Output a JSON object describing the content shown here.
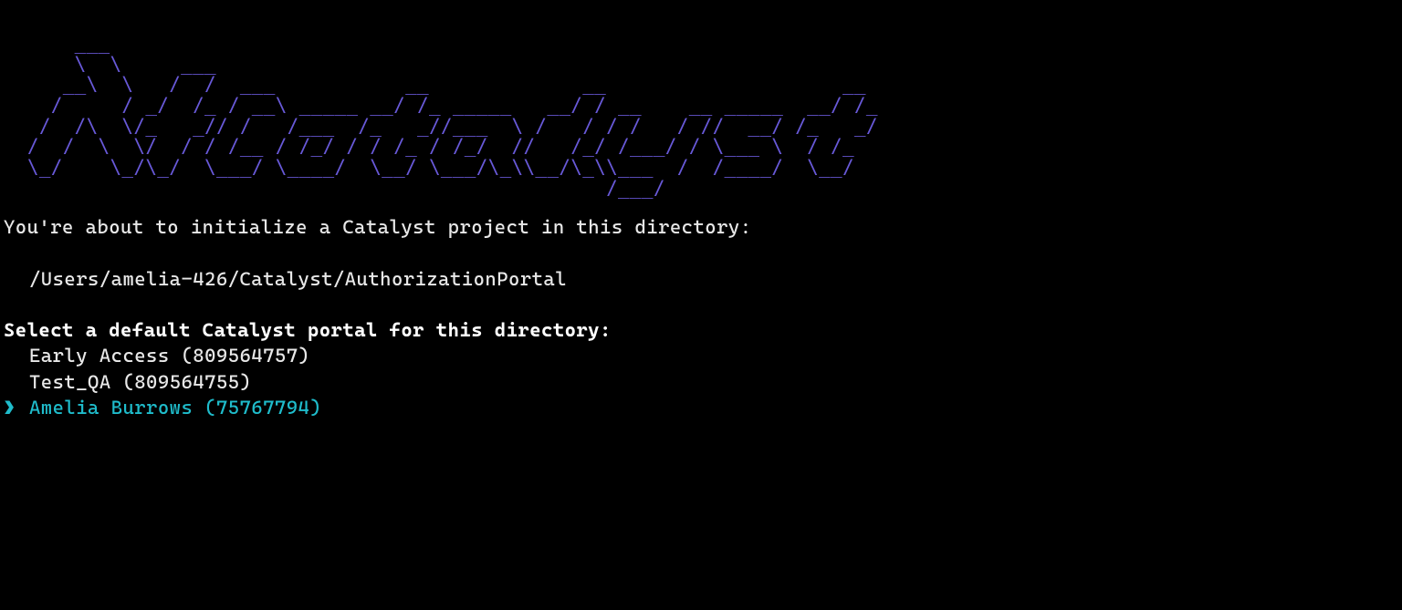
{
  "logo": {
    "ascii": "      ___\n      \\  \\     ___\n     __\\  \\   /  /  ___           __             __                    __\n    /     / _/  /_ / __\\ _____ __/ /_ _____   __/ / __    __ _____  __/ /_\n   /  /\\  \\/_   _// /   /___  /_   _//___  \\ /   / / /   / //  __/ /_   _/\n  /  /  \\  \\/  / / /__ / /_/ / / /_ / /_/  //   /_/ /___/ / \\___ \\  / /_\n  \\_/    \\_/\\_/  \\___/ \\____/  \\__/ \\___/\\_\\\\__/\\_\\\\___  /  /____/  \\__/\n                                                   /___/"
  },
  "intro": "You're about to initialize a Catalyst project in this directory:",
  "directory_path": "/Users/amelia-426/Catalyst/AuthorizationPortal",
  "prompt_heading": "Select a default Catalyst portal for this directory:",
  "selection_marker": "❯",
  "options": [
    {
      "label": "Early Access (809564757)",
      "selected": false
    },
    {
      "label": "Test_QA (809564755)",
      "selected": false
    },
    {
      "label": "Amelia Burrows (75767794)",
      "selected": true
    }
  ],
  "colors": {
    "background": "#000000",
    "text": "#e8e8e8",
    "logo": "#6859d8",
    "highlight": "#1fbccb"
  }
}
